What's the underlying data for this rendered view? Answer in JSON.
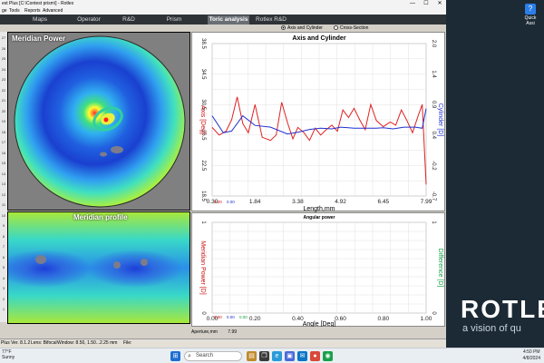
{
  "window": {
    "title": "est Plus [C:\\Contest prism\\] - Rotlex",
    "minimize": "—",
    "maximize": "☐",
    "close": "✕"
  },
  "menu": [
    "ge",
    "Tools",
    "Reports",
    "Advanced"
  ],
  "tabs": [
    {
      "label": "Maps",
      "active": false
    },
    {
      "label": "Operator",
      "active": false
    },
    {
      "label": "R&D",
      "active": false
    },
    {
      "label": "Prism",
      "active": false
    },
    {
      "label": "Toric analysis",
      "active": true
    },
    {
      "label": "Rotlex R&D",
      "active": false
    }
  ],
  "view_options": {
    "axis_cyl": "Axis and Cylinder",
    "cross_section": "Cross-Section",
    "selected": "axis_cyl"
  },
  "left_ruler": [
    "27",
    "26",
    "25",
    "24",
    "23",
    "22",
    "21",
    "20",
    "19",
    "18",
    "17",
    "16",
    "15",
    "14",
    "13",
    "12",
    "11",
    "10",
    "9",
    "8",
    "7",
    "6",
    "5",
    "4",
    "3",
    "2",
    "1"
  ],
  "map1": {
    "title": "Meridian Power"
  },
  "map2": {
    "title": "Meridian profile"
  },
  "chart_data": [
    {
      "type": "line",
      "title": "Axis and Cylinder",
      "xlabel": "Length,mm",
      "ylabel_left": "Axis [Deg]",
      "ylabel_right": "Cylinder [D]",
      "xlim": [
        0.3,
        7.99
      ],
      "x_ticks": [
        "0.30",
        "1.84",
        "3.38",
        "4.92",
        "6.45",
        "7.99"
      ],
      "ylim_left": [
        18.5,
        38.5
      ],
      "y_ticks_left": [
        "38.5",
        "34.5",
        "30.5",
        "26.5",
        "22.5",
        "18.5"
      ],
      "ylim_right": [
        -0.7,
        2.0
      ],
      "y_ticks_right": [
        "2.0",
        "1.4",
        "0.9",
        "0.4",
        "-0.2",
        "-0.7"
      ],
      "footer_values": [
        "0.00",
        "0.00"
      ],
      "series": [
        {
          "name": "Axis",
          "color": "#e02020",
          "x": [
            0.3,
            0.55,
            0.8,
            1.0,
            1.2,
            1.4,
            1.6,
            1.84,
            2.1,
            2.4,
            2.6,
            2.8,
            3.0,
            3.2,
            3.38,
            3.6,
            3.8,
            4.0,
            4.2,
            4.4,
            4.6,
            4.8,
            5.0,
            5.2,
            5.4,
            5.6,
            5.8,
            6.0,
            6.2,
            6.45,
            6.7,
            6.9,
            7.1,
            7.3,
            7.5,
            7.7,
            7.85,
            7.99
          ],
          "values": [
            27.5,
            26.5,
            27.0,
            28.5,
            31.5,
            28.0,
            26.8,
            30.5,
            26.2,
            25.8,
            26.5,
            30.8,
            28.2,
            26.0,
            27.5,
            26.8,
            25.8,
            27.4,
            26.5,
            27.2,
            27.8,
            27.0,
            29.8,
            28.8,
            30.0,
            28.5,
            27.2,
            30.5,
            28.4,
            27.6,
            28.2,
            27.8,
            29.8,
            28.4,
            26.8,
            29.0,
            30.5,
            20.0
          ]
        },
        {
          "name": "Cylinder",
          "color": "#2030d0",
          "x": [
            0.3,
            0.7,
            1.0,
            1.4,
            1.84,
            2.4,
            3.0,
            3.38,
            3.8,
            4.2,
            4.6,
            4.92,
            5.4,
            5.8,
            6.2,
            6.45,
            6.8,
            7.2,
            7.6,
            7.85,
            7.99
          ],
          "values": [
            0.72,
            0.42,
            0.45,
            0.72,
            0.55,
            0.52,
            0.4,
            0.43,
            0.48,
            0.5,
            0.49,
            0.52,
            0.5,
            0.5,
            0.5,
            0.51,
            0.49,
            0.52,
            0.52,
            0.5,
            0.85
          ]
        }
      ]
    },
    {
      "type": "line",
      "title": "Angular power",
      "xlabel": "Angle [Deg]",
      "ylabel_left": "Meridian Power [D]",
      "ylabel_right": "Difference [D]",
      "xlim": [
        0.0,
        1.0
      ],
      "x_ticks": [
        "0.00",
        "0.20",
        "0.40",
        "0.60",
        "0.80",
        "1.00"
      ],
      "ylim_left": [
        0,
        1
      ],
      "y_ticks_left": [
        "1",
        "0"
      ],
      "ylim_right": [
        0,
        1
      ],
      "y_ticks_right": [
        "1",
        "0"
      ],
      "footer_values": [
        "0.00",
        "0.00",
        "0.00"
      ],
      "series": []
    }
  ],
  "aperture": {
    "label": "Aperture,mm",
    "value": "7.99"
  },
  "statusbar": {
    "version": "Plus Ver. 8.1.2",
    "lens_label": "Lens: Bifocal",
    "window_label": "Window: 8.50, 1.50...2.25 mm",
    "file_label": "File:"
  },
  "desktop": {
    "brand": "ROTLEX",
    "tagline": "a vision of qu",
    "icon_label": "Quick Assi",
    "icon_glyph": "?"
  },
  "taskbar": {
    "weather_temp": "77°F",
    "weather_desc": "Sunny",
    "search_placeholder": "Search",
    "time": "4:50 PM",
    "date": "4/8/2024",
    "icons": [
      "start-icon",
      "file-explorer-icon",
      "browser-icon",
      "store-icon",
      "mail-icon",
      "chrome-icon",
      "rotlex-app-icon"
    ]
  }
}
